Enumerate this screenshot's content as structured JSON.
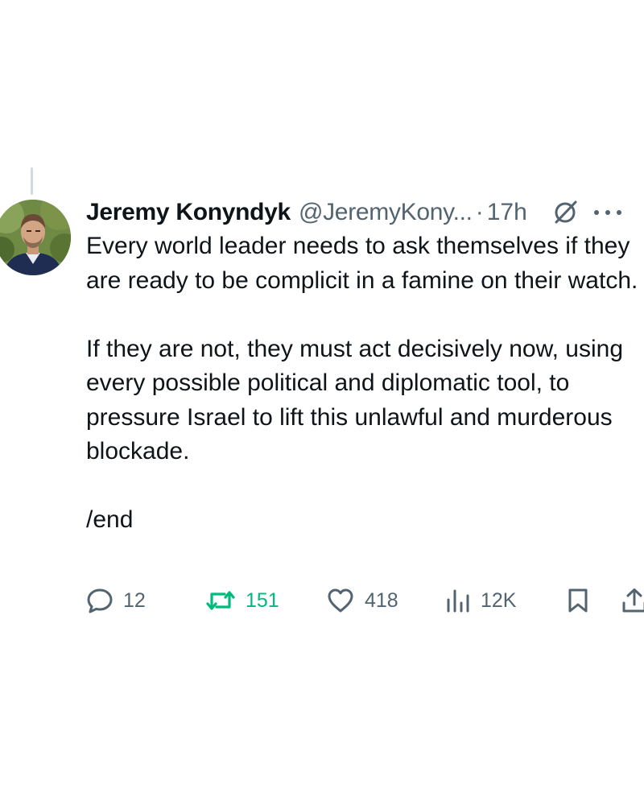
{
  "tweet": {
    "author": {
      "display_name": "Jeremy Konyndyk",
      "handle": "@JeremyKony...",
      "time_separator": "·",
      "time": "17h"
    },
    "paragraphs": [
      "Every world leader needs to ask themselves if they are ready to be complicit in a famine on their watch.",
      "If they are not, they must act decisively now, using every possible political and diplomatic tool, to pressure Israel to lift this unlawful and murderous blockade.",
      "/end"
    ],
    "actions": {
      "replies": "12",
      "reposts": "151",
      "likes": "418",
      "views": "12K"
    },
    "icons": {
      "grok": "grok-icon",
      "more": "more-icon",
      "reply": "reply-icon",
      "repost": "repost-icon",
      "like": "heart-icon",
      "views": "views-icon",
      "bookmark": "bookmark-icon",
      "share": "share-icon"
    },
    "colors": {
      "text": "#0f1419",
      "secondary": "#536471",
      "repost_active": "#00ba7c",
      "thread_line": "#cfd9de"
    }
  }
}
